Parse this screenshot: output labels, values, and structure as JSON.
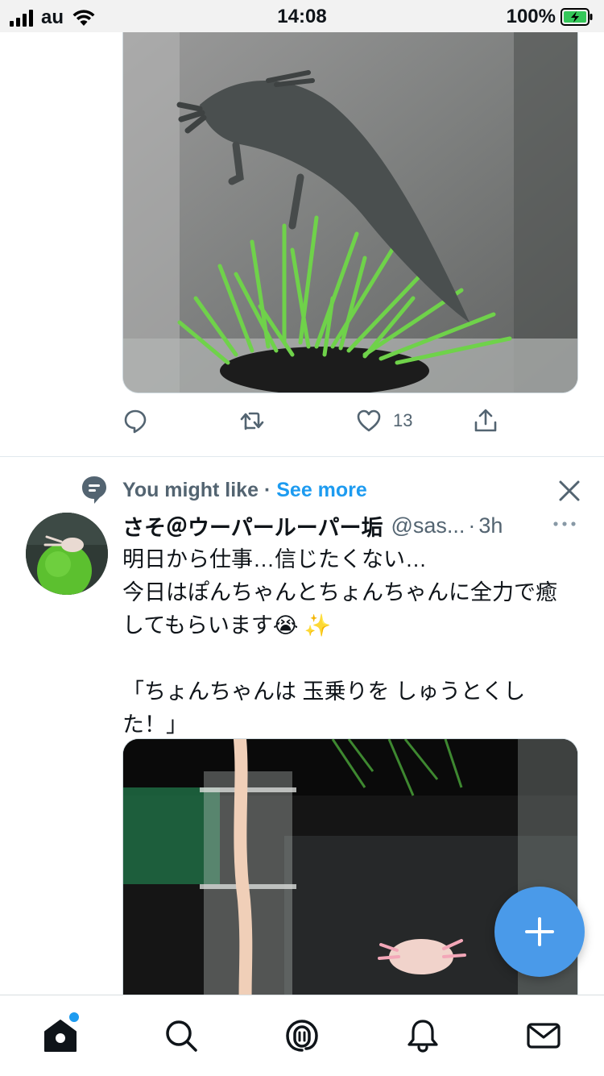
{
  "status_bar": {
    "carrier": "au",
    "time": "14:08",
    "battery_percent": "100%"
  },
  "tweet1": {
    "actions": {
      "reply_icon": "reply-icon",
      "retweet_icon": "retweet-icon",
      "like_icon": "heart-icon",
      "like_count": "13",
      "share_icon": "share-icon"
    }
  },
  "suggestion": {
    "label": "You might like",
    "separator": "·",
    "see_more": "See more",
    "dismiss_icon": "close-icon"
  },
  "tweet2": {
    "display_name": "さそ＠ウーパールーパー垢",
    "handle": "@sas...",
    "separator": "·",
    "time": "3h",
    "text": "明日から仕事…信じたくない…\n今日はぽんちゃんとちょんちゃんに全力で癒\nしてもらいます😭 ✨\n\n「ちょんちゃんは 玉乗りを しゅうとくし\nた！」"
  },
  "fab": {
    "icon": "plus-icon"
  },
  "tab_bar": {
    "items": [
      "home-icon",
      "search-icon",
      "spaces-icon",
      "notifications-icon",
      "messages-icon"
    ],
    "home_has_new": true
  },
  "colors": {
    "accent": "#1d9bf0",
    "fab": "#4a9ae9",
    "secondary_text": "#536471"
  }
}
